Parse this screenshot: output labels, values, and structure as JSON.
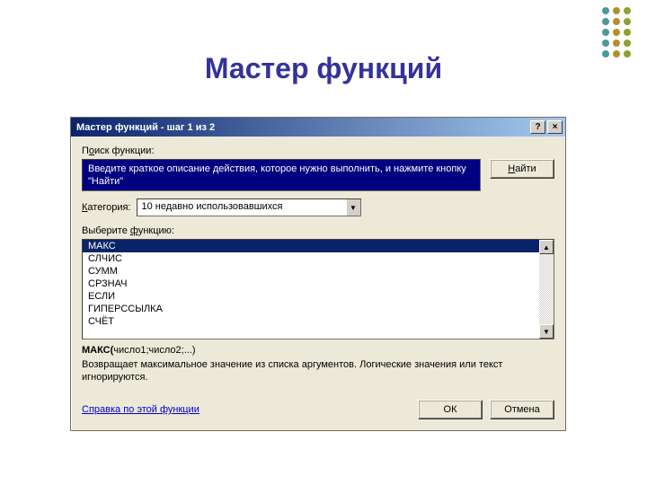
{
  "slide": {
    "title": "Мастер функций"
  },
  "dialog": {
    "title": "Мастер функций - шаг 1 из 2",
    "help_btn": "?",
    "close_btn": "×",
    "search_label_pre": "П",
    "search_label_u": "о",
    "search_label_post": "иск функции:",
    "search_text": "Введите краткое описание действия, которое нужно выполнить, и нажмите кнопку \"Найти\"",
    "find_btn_u": "Н",
    "find_btn_post": "айти",
    "category_label_u": "К",
    "category_label_post": "атегория:",
    "category_value": "10 недавно использовавшихся",
    "select_label_pre": "Выберите ",
    "select_label_u": "ф",
    "select_label_post": "ункцию:",
    "functions": [
      "МАКС",
      "СЛЧИС",
      "СУММ",
      "СРЗНАЧ",
      "ЕСЛИ",
      "ГИПЕРССЫЛКА",
      "СЧЁТ"
    ],
    "selected_index": 0,
    "syntax_name": "МАКС(",
    "syntax_args": "число1;число2;...)",
    "description": "Возвращает максимальное значение из списка аргументов. Логические значения или текст игнорируются.",
    "help_link": "Справка по этой функции",
    "ok_btn": "ОК",
    "cancel_btn": "Отмена"
  }
}
